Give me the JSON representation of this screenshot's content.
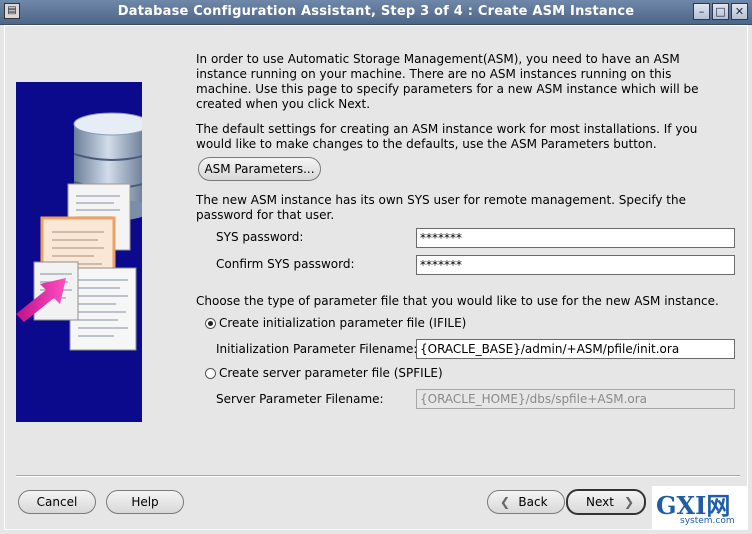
{
  "window": {
    "title": "Database Configuration Assistant, Step 3 of 4 : Create ASM Instance",
    "app_icon": "dbca-icon",
    "controls": {
      "minimize": "–",
      "maximize": "□",
      "close": "✕"
    }
  },
  "main": {
    "intro": "In order to use Automatic Storage Management(ASM), you need to have an ASM instance running on your machine. There are no ASM instances running on this machine. Use this page to specify parameters for a new ASM instance which will be created when you click Next.",
    "defaults_text": "The default settings for creating an ASM instance work for most installations. If you would like to make changes to the defaults, use the ASM Parameters button.",
    "asm_parameters_button": "ASM Parameters...",
    "sys_user_text": "The new ASM instance has its own SYS user for remote management. Specify the password for that user.",
    "sys_password_label": "SYS password:",
    "sys_password_value": "*******",
    "confirm_password_label": "Confirm SYS password:",
    "confirm_password_value": "*******",
    "param_file_text": "Choose the type of parameter file that you would like to use for the new ASM instance.",
    "ifile_option": "Create initialization parameter file (IFILE)",
    "ifile_selected": true,
    "ifile_filename_label": "Initialization Parameter Filename:",
    "ifile_filename_value": "{ORACLE_BASE}/admin/+ASM/pfile/init.ora",
    "spfile_option": "Create server parameter file (SPFILE)",
    "spfile_selected": false,
    "spfile_filename_label": "Server Parameter Filename:",
    "spfile_filename_value": "{ORACLE_HOME}/dbs/spfile+ASM.ora"
  },
  "footer": {
    "cancel": "Cancel",
    "help": "Help",
    "back": "Back",
    "next": "Next"
  },
  "watermark": {
    "text": "GXI网",
    "subtext": "system.com"
  }
}
